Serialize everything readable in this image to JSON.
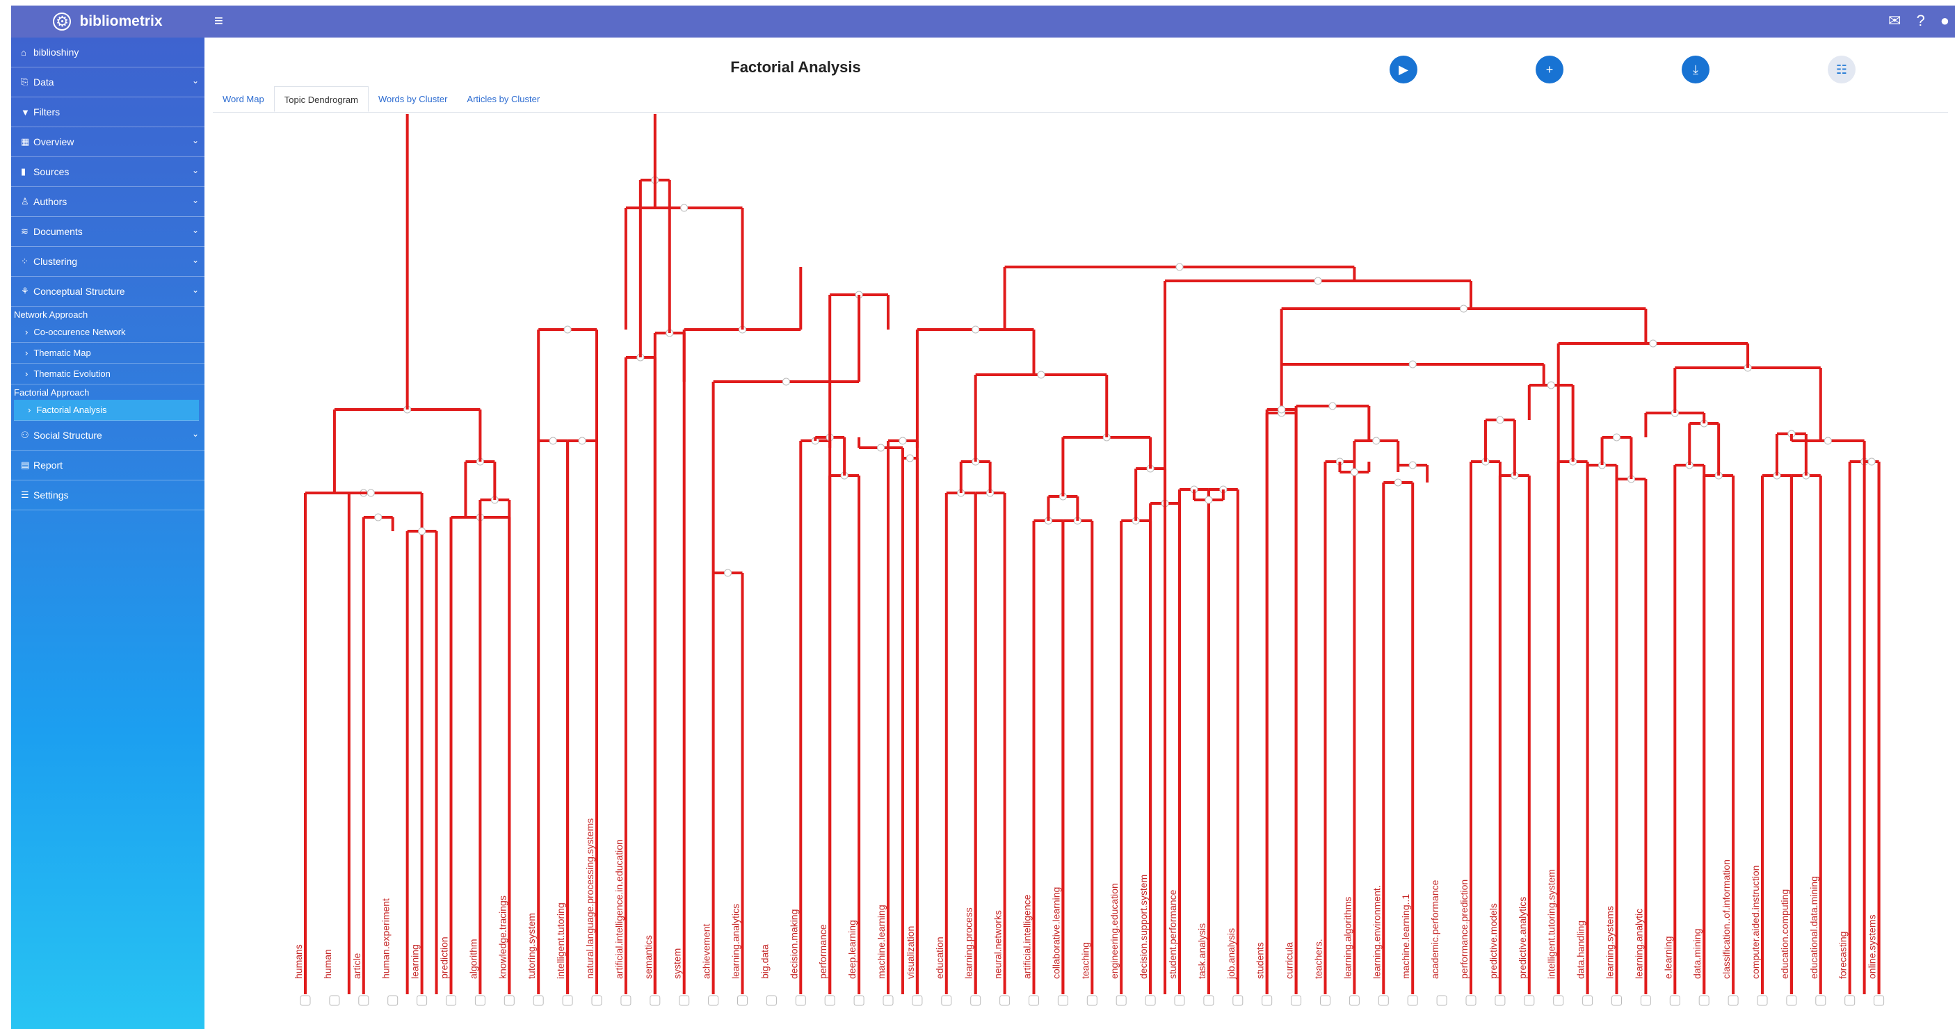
{
  "app": {
    "name": "bibliometrix"
  },
  "sidebar": {
    "items": [
      {
        "label": "biblioshiny",
        "icon": "home-icon"
      },
      {
        "label": "Data",
        "icon": "data-icon"
      },
      {
        "label": "Filters",
        "icon": "filter-icon"
      },
      {
        "label": "Overview",
        "icon": "overview-icon"
      },
      {
        "label": "Sources",
        "icon": "book-icon"
      },
      {
        "label": "Authors",
        "icon": "user-icon"
      },
      {
        "label": "Documents",
        "icon": "documents-icon"
      },
      {
        "label": "Clustering",
        "icon": "spinner-icon"
      },
      {
        "label": "Conceptual Structure",
        "icon": "structure-icon"
      }
    ],
    "network_approach": "Network Approach",
    "network_items": [
      "Co-occurence Network",
      "Thematic Map",
      "Thematic Evolution"
    ],
    "factorial_approach": "Factorial Approach",
    "factorial_items": [
      "Factorial Analysis"
    ],
    "bottom_items": [
      {
        "label": "Social Structure",
        "icon": "users-icon"
      },
      {
        "label": "Report",
        "icon": "report-icon"
      },
      {
        "label": "Settings",
        "icon": "settings-icon"
      }
    ]
  },
  "main": {
    "title": "Factorial Analysis",
    "tabs": [
      "Word Map",
      "Topic Dendrogram",
      "Words by Cluster",
      "Articles by Cluster"
    ],
    "active_tab": "Topic Dendrogram"
  },
  "dendrogram": {
    "color": "#e01b1b",
    "labels": [
      "humans",
      "human",
      "article",
      "human.experiment",
      "learning",
      "prediction",
      "algorithm",
      "knowledge.tracings",
      "tutoring.system",
      "intelligent.tutoring",
      "natural.language.processing.systems",
      "artificial.intelligence.in.education",
      "semantics",
      "system",
      "achievement",
      "learning.analytics",
      "big.data",
      "decision.making",
      "performance",
      "deep.learning",
      "machine.learning",
      "visualization",
      "education",
      "learning.process",
      "neural.networks",
      "artificial.intelligence",
      "collaborative.learning",
      "teaching",
      "engineering.education",
      "decision.support.system",
      "student.performance",
      "task.analysis",
      "job.analysis",
      "students",
      "curricula",
      "teachers.",
      "learning.algorithms",
      "learning.environment.",
      "machine.learning..1",
      "academic.performance",
      "performance.prediction",
      "predictive.models",
      "predictive.analytics",
      "intelligent.tutoring.system",
      "data.handling",
      "learning.systems",
      "learning.analytic",
      "e.learning",
      "data.mining",
      "classification..of.information",
      "computer.aided.instruction",
      "education.computing",
      "educational.data.mining",
      "forecasting",
      "online.systems"
    ]
  }
}
